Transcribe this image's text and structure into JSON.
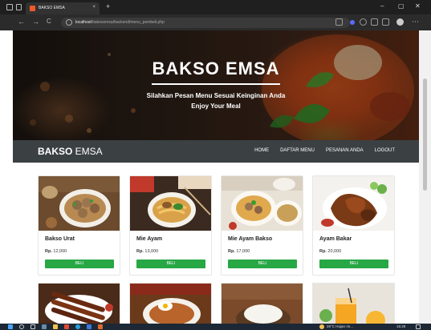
{
  "browser": {
    "tab_title": "BAKSO EMSA",
    "tab_close": "×",
    "new_tab": "+",
    "url_host": "localhost",
    "url_path": "/baksoemsa/backend/menu_pembeli.php",
    "back": "←",
    "forward": "→",
    "reload": "C",
    "minimize": "–",
    "maximize": "▢",
    "close": "✕",
    "menu": "⋯"
  },
  "hero": {
    "title": "BAKSO EMSA",
    "subtitle_line1": "Silahkan Pesan Menu Sesuai Keinginan Anda",
    "subtitle_line2": "Enjoy Your Meal"
  },
  "navbar": {
    "brand_bold": "BAKSO",
    "brand_rest": " EMSA",
    "links": [
      "HOME",
      "DAFTAR MENU",
      "PESANAN ANDA",
      "LOGOUT"
    ]
  },
  "menu": {
    "items": [
      {
        "name": "Bakso Urat",
        "price_label": "Rp.",
        "price": "12,000",
        "button": "BELI"
      },
      {
        "name": "Mie Ayam",
        "price_label": "Rp.",
        "price": "13,000",
        "button": "BELI"
      },
      {
        "name": "Mie Ayam Bakso",
        "price_label": "Rp.",
        "price": "17,000",
        "button": "BELI"
      },
      {
        "name": "Ayam Bakar",
        "price_label": "Rp.",
        "price": "20,000",
        "button": "BELI"
      }
    ]
  },
  "taskbar": {
    "weather": "26°C Hujan rin...",
    "time": "15:28"
  },
  "colors": {
    "accent_green": "#28a745",
    "navbar_bg": "#3b4043"
  }
}
